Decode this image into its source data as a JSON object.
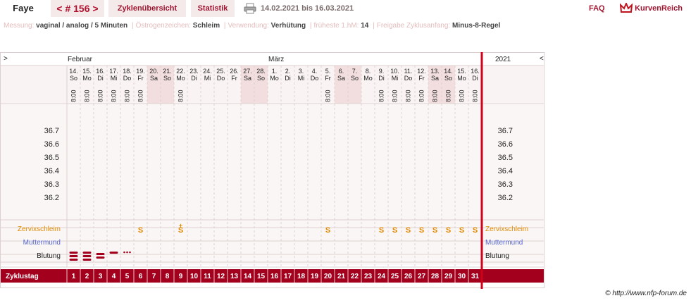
{
  "header": {
    "name": "Faye",
    "cycle_label": "< # 156 >",
    "tab_overview": "Zyklenübersicht",
    "tab_stats": "Statistik",
    "date_range": "14.02.2021 bis 16.03.2021",
    "faq": "FAQ",
    "logo": "KurvenReich"
  },
  "info": [
    {
      "label": "Messung:",
      "value": "vaginal / analog / 5 Minuten"
    },
    {
      "label": "Östrogenzeichen:",
      "value": "Schleim"
    },
    {
      "label": "Verwendung:",
      "value": "Verhütung"
    },
    {
      "label": "früheste 1.hM:",
      "value": "14"
    },
    {
      "label": "Freigabe Zyklusanfang:",
      "value": "Minus-8-Regel"
    }
  ],
  "chart": {
    "nav_left": ">",
    "nav_right": "<",
    "year": "2021",
    "months": [
      {
        "label": "Februar",
        "at_day": 1
      },
      {
        "label": "März",
        "at_day": 16
      }
    ],
    "dates": [
      "14.",
      "15.",
      "16.",
      "17.",
      "18.",
      "19.",
      "20.",
      "21.",
      "22.",
      "23.",
      "24.",
      "25.",
      "26.",
      "27.",
      "28.",
      "1.",
      "2.",
      "3.",
      "4.",
      "5.",
      "6.",
      "7.",
      "8.",
      "9.",
      "10.",
      "11.",
      "12.",
      "13.",
      "14.",
      "15.",
      "16."
    ],
    "weekdays": [
      "So",
      "Mo",
      "Di",
      "Mi",
      "Do",
      "Fr",
      "Sa",
      "So",
      "Mo",
      "Di",
      "Mi",
      "Do",
      "Fr",
      "Sa",
      "So",
      "Mo",
      "Di",
      "Mi",
      "Do",
      "Fr",
      "Sa",
      "So",
      "Mo",
      "Di",
      "Mi",
      "Do",
      "Fr",
      "Sa",
      "So",
      "Mo",
      "Di"
    ],
    "times": [
      "8:00",
      "8:00",
      "8:00",
      "8:00",
      "8:00",
      "8:00",
      "",
      "",
      "8:00",
      "",
      "",
      "",
      "",
      "",
      "",
      "",
      "",
      "",
      "",
      "8:00",
      "",
      "",
      "",
      "8:00",
      "8:00",
      "8:00",
      "8:00",
      "8:00",
      "8:00",
      "8:00",
      "8:00"
    ],
    "weekend_days": [
      7,
      8,
      14,
      15,
      21,
      22,
      28,
      29
    ],
    "temp_ticks": [
      "36.7",
      "36.6",
      "36.5",
      "36.4",
      "36.3",
      "36.2"
    ],
    "rows": {
      "cervix": "Zervixschleim",
      "mumu": "Muttermund",
      "bleeding": "Blutung",
      "cycleday": "Zyklustag"
    },
    "cervix_marks": [
      "",
      "",
      "",
      "",
      "",
      "S",
      "",
      "",
      "S+",
      "",
      "",
      "",
      "",
      "",
      "",
      "",
      "",
      "",
      "",
      "S",
      "",
      "",
      "",
      "S",
      "S",
      "S",
      "S",
      "S",
      "S",
      "S",
      "S"
    ],
    "bleeding": [
      "heavy",
      "heavy",
      "medium",
      "light",
      "spotting",
      "",
      "",
      "",
      "",
      "",
      "",
      "",
      "",
      "",
      "",
      "",
      "",
      "",
      "",
      "",
      "",
      "",
      "",
      "",
      "",
      "",
      "",
      "",
      "",
      "",
      ""
    ],
    "colors": {
      "accent": "#a3001e",
      "cervix": "#e08a00",
      "mumu": "#5566cc",
      "weekend": "#f2dede",
      "grid": "#dcd0d0"
    }
  },
  "copyright": "© http://www.nfp-forum.de"
}
